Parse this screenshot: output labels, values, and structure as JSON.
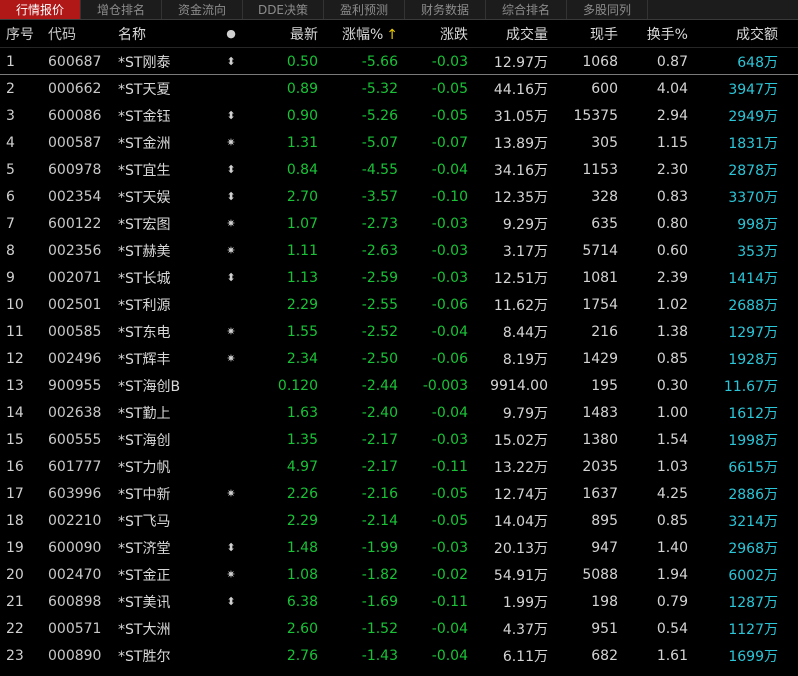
{
  "tabs": [
    {
      "label": "行情报价",
      "active": true
    },
    {
      "label": "增仓排名",
      "active": false
    },
    {
      "label": "资金流向",
      "active": false
    },
    {
      "label": "DDE决策",
      "active": false
    },
    {
      "label": "盈利预测",
      "active": false
    },
    {
      "label": "财务数据",
      "active": false
    },
    {
      "label": "综合排名",
      "active": false
    },
    {
      "label": "多股同列",
      "active": false
    }
  ],
  "columns": {
    "seq": "序号",
    "code": "代码",
    "name": "名称",
    "mark": "●",
    "latest": "最新",
    "pct": "涨幅%",
    "sort_arrow": "↑",
    "chg": "涨跌",
    "vol": "成交量",
    "hand": "现手",
    "turn": "换手%",
    "amt": "成交额"
  },
  "rows": [
    {
      "seq": "1",
      "code": "600687",
      "name": "*ST刚泰",
      "mark": "⬍",
      "latest": "0.50",
      "pct": "-5.66",
      "chg": "-0.03",
      "vol": "12.97万",
      "hand": "1068",
      "turn": "0.87",
      "amt": "648万"
    },
    {
      "seq": "2",
      "code": "000662",
      "name": "*ST天夏",
      "mark": "",
      "latest": "0.89",
      "pct": "-5.32",
      "chg": "-0.05",
      "vol": "44.16万",
      "hand": "600",
      "turn": "4.04",
      "amt": "3947万"
    },
    {
      "seq": "3",
      "code": "600086",
      "name": "*ST金钰",
      "mark": "⬍",
      "latest": "0.90",
      "pct": "-5.26",
      "chg": "-0.05",
      "vol": "31.05万",
      "hand": "15375",
      "turn": "2.94",
      "amt": "2949万"
    },
    {
      "seq": "4",
      "code": "000587",
      "name": "*ST金洲",
      "mark": "✷",
      "latest": "1.31",
      "pct": "-5.07",
      "chg": "-0.07",
      "vol": "13.89万",
      "hand": "305",
      "turn": "1.15",
      "amt": "1831万"
    },
    {
      "seq": "5",
      "code": "600978",
      "name": "*ST宜生",
      "mark": "⬍",
      "latest": "0.84",
      "pct": "-4.55",
      "chg": "-0.04",
      "vol": "34.16万",
      "hand": "1153",
      "turn": "2.30",
      "amt": "2878万"
    },
    {
      "seq": "6",
      "code": "002354",
      "name": "*ST天娱",
      "mark": "⬍",
      "latest": "2.70",
      "pct": "-3.57",
      "chg": "-0.10",
      "vol": "12.35万",
      "hand": "328",
      "turn": "0.83",
      "amt": "3370万"
    },
    {
      "seq": "7",
      "code": "600122",
      "name": "*ST宏图",
      "mark": "✷",
      "latest": "1.07",
      "pct": "-2.73",
      "chg": "-0.03",
      "vol": "9.29万",
      "hand": "635",
      "turn": "0.80",
      "amt": "998万"
    },
    {
      "seq": "8",
      "code": "002356",
      "name": "*ST赫美",
      "mark": "✷",
      "latest": "1.11",
      "pct": "-2.63",
      "chg": "-0.03",
      "vol": "3.17万",
      "hand": "5714",
      "turn": "0.60",
      "amt": "353万"
    },
    {
      "seq": "9",
      "code": "002071",
      "name": "*ST长城",
      "mark": "⬍",
      "latest": "1.13",
      "pct": "-2.59",
      "chg": "-0.03",
      "vol": "12.51万",
      "hand": "1081",
      "turn": "2.39",
      "amt": "1414万"
    },
    {
      "seq": "10",
      "code": "002501",
      "name": "*ST利源",
      "mark": "",
      "latest": "2.29",
      "pct": "-2.55",
      "chg": "-0.06",
      "vol": "11.62万",
      "hand": "1754",
      "turn": "1.02",
      "amt": "2688万"
    },
    {
      "seq": "11",
      "code": "000585",
      "name": "*ST东电",
      "mark": "✷",
      "latest": "1.55",
      "pct": "-2.52",
      "chg": "-0.04",
      "vol": "8.44万",
      "hand": "216",
      "turn": "1.38",
      "amt": "1297万"
    },
    {
      "seq": "12",
      "code": "002496",
      "name": "*ST辉丰",
      "mark": "✷",
      "latest": "2.34",
      "pct": "-2.50",
      "chg": "-0.06",
      "vol": "8.19万",
      "hand": "1429",
      "turn": "0.85",
      "amt": "1928万"
    },
    {
      "seq": "13",
      "code": "900955",
      "name": "*ST海创B",
      "mark": "",
      "latest": "0.120",
      "pct": "-2.44",
      "chg": "-0.003",
      "vol": "9914.00",
      "hand": "195",
      "turn": "0.30",
      "amt": "11.67万"
    },
    {
      "seq": "14",
      "code": "002638",
      "name": "*ST勤上",
      "mark": "",
      "latest": "1.63",
      "pct": "-2.40",
      "chg": "-0.04",
      "vol": "9.79万",
      "hand": "1483",
      "turn": "1.00",
      "amt": "1612万"
    },
    {
      "seq": "15",
      "code": "600555",
      "name": "*ST海创",
      "mark": "",
      "latest": "1.35",
      "pct": "-2.17",
      "chg": "-0.03",
      "vol": "15.02万",
      "hand": "1380",
      "turn": "1.54",
      "amt": "1998万"
    },
    {
      "seq": "16",
      "code": "601777",
      "name": "*ST力帆",
      "mark": "",
      "latest": "4.97",
      "pct": "-2.17",
      "chg": "-0.11",
      "vol": "13.22万",
      "hand": "2035",
      "turn": "1.03",
      "amt": "6615万"
    },
    {
      "seq": "17",
      "code": "603996",
      "name": "*ST中新",
      "mark": "✷",
      "latest": "2.26",
      "pct": "-2.16",
      "chg": "-0.05",
      "vol": "12.74万",
      "hand": "1637",
      "turn": "4.25",
      "amt": "2886万"
    },
    {
      "seq": "18",
      "code": "002210",
      "name": "*ST飞马",
      "mark": "",
      "latest": "2.29",
      "pct": "-2.14",
      "chg": "-0.05",
      "vol": "14.04万",
      "hand": "895",
      "turn": "0.85",
      "amt": "3214万"
    },
    {
      "seq": "19",
      "code": "600090",
      "name": "*ST济堂",
      "mark": "⬍",
      "latest": "1.48",
      "pct": "-1.99",
      "chg": "-0.03",
      "vol": "20.13万",
      "hand": "947",
      "turn": "1.40",
      "amt": "2968万"
    },
    {
      "seq": "20",
      "code": "002470",
      "name": "*ST金正",
      "mark": "✷",
      "latest": "1.08",
      "pct": "-1.82",
      "chg": "-0.02",
      "vol": "54.91万",
      "hand": "5088",
      "turn": "1.94",
      "amt": "6002万"
    },
    {
      "seq": "21",
      "code": "600898",
      "name": "*ST美讯",
      "mark": "⬍",
      "latest": "6.38",
      "pct": "-1.69",
      "chg": "-0.11",
      "vol": "1.99万",
      "hand": "198",
      "turn": "0.79",
      "amt": "1287万"
    },
    {
      "seq": "22",
      "code": "000571",
      "name": "*ST大洲",
      "mark": "",
      "latest": "2.60",
      "pct": "-1.52",
      "chg": "-0.04",
      "vol": "4.37万",
      "hand": "951",
      "turn": "0.54",
      "amt": "1127万"
    },
    {
      "seq": "23",
      "code": "000890",
      "name": "*ST胜尔",
      "mark": "",
      "latest": "2.76",
      "pct": "-1.43",
      "chg": "-0.04",
      "vol": "6.11万",
      "hand": "682",
      "turn": "1.61",
      "amt": "1699万"
    }
  ],
  "colors": {
    "down": "#19c237",
    "amount": "#2bc6d8",
    "active_tab": "#b01818",
    "background": "#000000"
  }
}
